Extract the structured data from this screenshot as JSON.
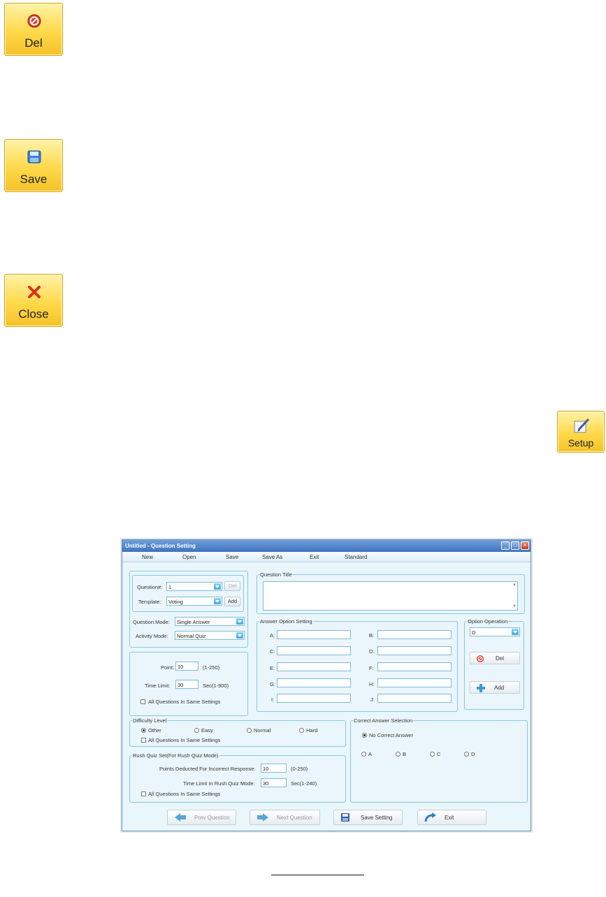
{
  "buttons": {
    "del": "Del",
    "save": "Save",
    "close": "Close",
    "setup": "Setup"
  },
  "dialog": {
    "title": "Untitled - Question Setting",
    "window_controls": {
      "minimize": "_",
      "maximize": "□",
      "close": "×"
    },
    "menu": [
      "New",
      "Open",
      "Save",
      "Save As",
      "Exit",
      "Standard"
    ],
    "question": {
      "question_no_label": "Question#:",
      "question_no_value": "1",
      "del_label": "Del",
      "template_label": "Template:",
      "template_value": "Voting",
      "add_label": "Add",
      "question_mode_label": "Question Mode:",
      "question_mode_value": "Single Answer",
      "activity_mode_label": "Activity Mode:",
      "activity_mode_value": "Normal Quiz"
    },
    "points": {
      "point_label": "Point:",
      "point_value": "10",
      "point_range": "(1-250)",
      "time_limit_label": "Time Limit:",
      "time_limit_value": "30",
      "time_limit_range": "Sec(1-900)",
      "same_settings_label": "All Questions In Same Settings"
    },
    "question_title": {
      "legend": "Question Title",
      "value": ""
    },
    "answer_options": {
      "legend": "Answer Option Setting",
      "left": [
        "A:",
        "C:",
        "E:",
        "G:",
        "I:"
      ],
      "right": [
        "B:",
        "D:",
        "F:",
        "H:",
        "J:"
      ]
    },
    "option_operation": {
      "legend": "Option Operation",
      "selected": "D",
      "del_label": "Del",
      "add_label": "Add"
    },
    "difficulty": {
      "legend": "Difficulty Level",
      "options": [
        "Other",
        "Easy",
        "Normal",
        "Hard"
      ],
      "selected": "Other",
      "same_settings_label": "All Questions In Same Settings"
    },
    "rush": {
      "legend": "Rush Quiz Set(For Rush Quiz Mode)",
      "deduct_label": "Points Deducted For Incorrect Response:",
      "deduct_value": "10",
      "deduct_range": "(0-250)",
      "time_label": "Time Limit In Rush Quiz Mode:",
      "time_value": "30",
      "time_range": "Sec(1-240)",
      "same_settings_label": "All Questions In Same Settings"
    },
    "correct_answer": {
      "legend": "Correct Answer Selection",
      "no_correct_label": "No Correct Answer",
      "options": [
        "A",
        "B",
        "C",
        "D"
      ]
    },
    "footer": {
      "prev": "Prev Question",
      "next": "Next Question",
      "save_setting": "Save Setting",
      "exit": "Exit"
    }
  },
  "icons": {
    "del": "prohibit-icon",
    "save": "floppy-disk-icon",
    "close": "red-x-icon",
    "setup": "edit-pencil-icon"
  },
  "colors": {
    "button_yellow": "#ffd94a",
    "window_bg": "#e9f6fb",
    "titlebar": "#3f72bd",
    "group_border": "#88c8e0"
  }
}
